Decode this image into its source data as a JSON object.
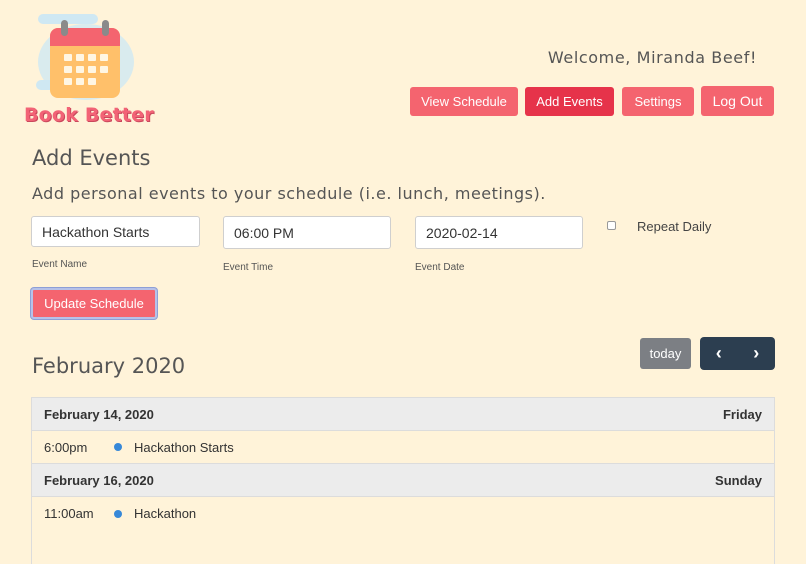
{
  "brand": {
    "name": "Book Better"
  },
  "header": {
    "welcome": "Welcome, Miranda Beef!"
  },
  "nav": [
    {
      "label": "View Schedule",
      "active": false
    },
    {
      "label": "Add Events",
      "active": true
    },
    {
      "label": "Settings",
      "active": false
    },
    {
      "label": "Log Out",
      "active": false
    }
  ],
  "form": {
    "title": "Add Events",
    "subtitle": "Add personal events to your schedule (i.e. lunch, meetings).",
    "event_name": {
      "value": "Hackathon Starts",
      "label": "Event Name"
    },
    "event_time": {
      "value": "06:00 PM",
      "label": "Event Time"
    },
    "event_date": {
      "value": "2020-02-14",
      "label": "Event Date"
    },
    "repeat_label": "Repeat Daily",
    "repeat_checked": false,
    "submit_label": "Update Schedule"
  },
  "calendar": {
    "month_title": "February 2020",
    "today_label": "today",
    "prev_icon": "chevron-left",
    "next_icon": "chevron-right",
    "days": [
      {
        "date": "February 14, 2020",
        "weekday": "Friday",
        "events": [
          {
            "time": "6:00pm",
            "title": "Hackathon Starts"
          }
        ]
      },
      {
        "date": "February 16, 2020",
        "weekday": "Sunday",
        "events": [
          {
            "time": "11:00am",
            "title": "Hackathon"
          }
        ]
      }
    ]
  },
  "colors": {
    "background": "#fff3d9",
    "accent": "#f4646f",
    "accent_active": "#e6334a",
    "dark_nav": "#2c3e50",
    "event_dot": "#3788d8"
  }
}
